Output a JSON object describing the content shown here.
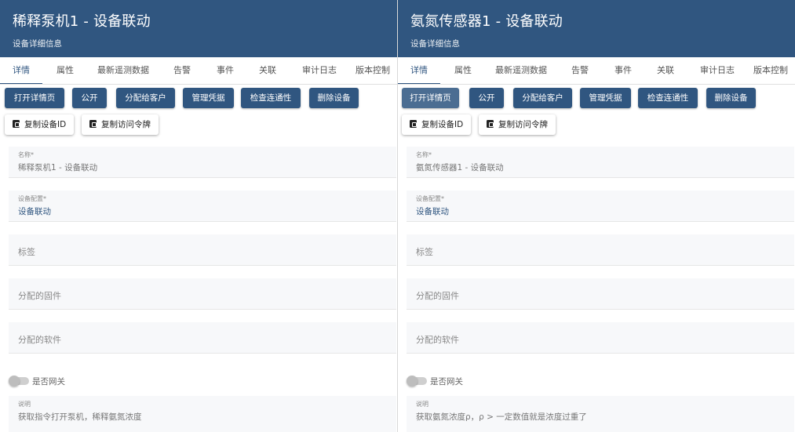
{
  "tabs": [
    "详情",
    "属性",
    "最新遥测数据",
    "告警",
    "事件",
    "关联",
    "审计日志",
    "版本控制"
  ],
  "buttons": {
    "open_details": "打开详情页",
    "make_public": "公开",
    "assign_customer": "分配给客户",
    "manage_credentials": "管理凭据",
    "check_connectivity": "检查连通性",
    "delete_device": "删除设备",
    "copy_device_id": "复制设备ID",
    "copy_access_token": "复制访问令牌"
  },
  "fields": {
    "name_label": "名称*",
    "profile_label": "设备配置*",
    "label_placeholder": "标签",
    "firmware_placeholder": "分配的固件",
    "software_placeholder": "分配的软件",
    "gateway_label": "是否网关",
    "description_label": "说明"
  },
  "left": {
    "title": "稀释泵机1 - 设备联动",
    "subtitle": "设备详细信息",
    "name_value": "稀释泵机1 - 设备联动",
    "profile_value": "设备联动",
    "description_value": "获取指令打开泵机，稀释氨氮浓度",
    "is_gateway": false
  },
  "right": {
    "title": "氨氮传感器1 - 设备联动",
    "subtitle": "设备详细信息",
    "name_value": "氨氮传感器1 - 设备联动",
    "profile_value": "设备联动",
    "description_value": "获取氨氮浓度ρ，ρ > 一定数值就是浓度过重了",
    "is_gateway": false
  },
  "colors": {
    "header": "#305680",
    "accent": "#305680",
    "field_background": "#f7f8fa"
  }
}
